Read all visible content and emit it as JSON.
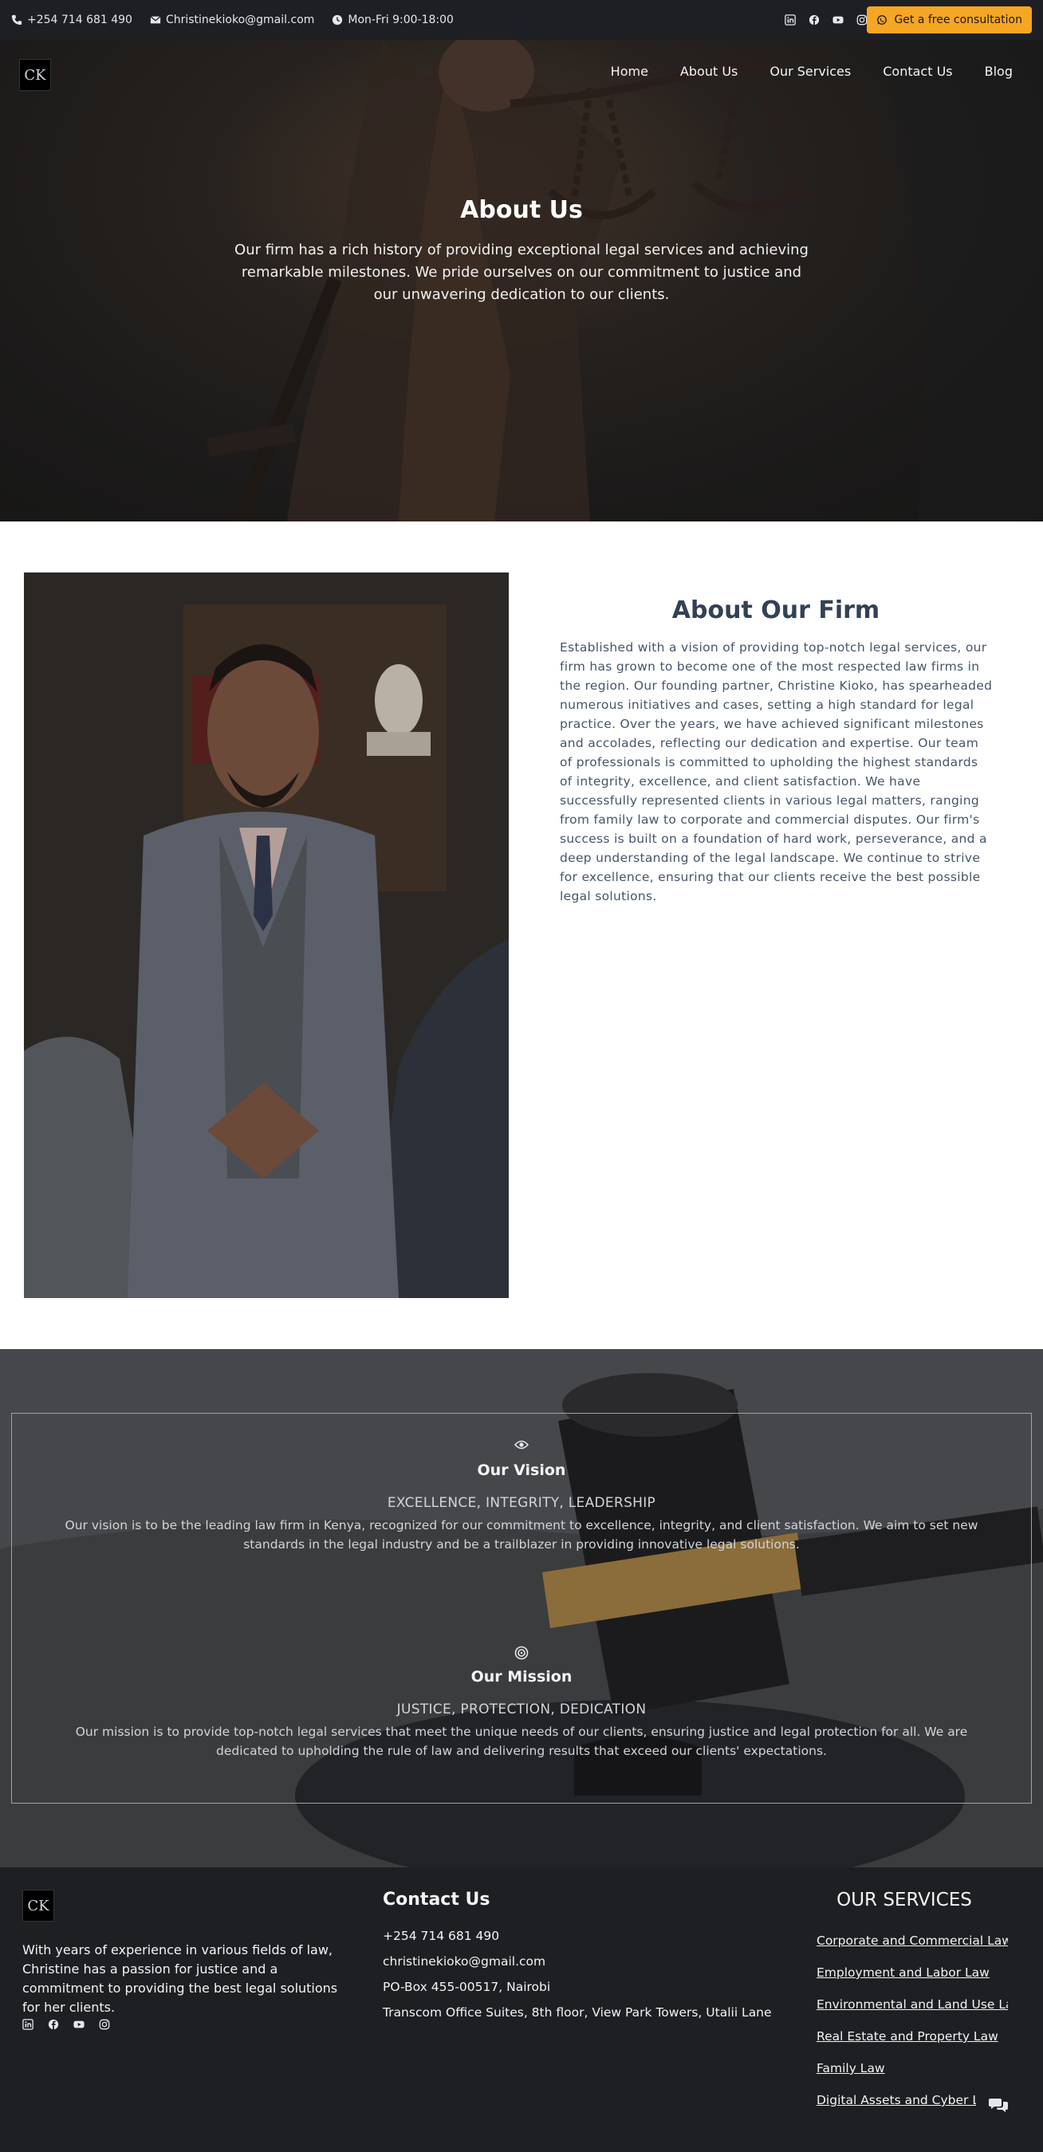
{
  "topbar": {
    "phone": "+254 714 681 490",
    "email": "Christinekioko@gmail.com",
    "hours": "Mon-Fri 9:00-18:00",
    "social_icons": [
      "linkedin-icon",
      "facebook-icon",
      "youtube-icon",
      "instagram-icon"
    ],
    "consult_label": "Get a free consultation",
    "accent": "#f5a623"
  },
  "header": {
    "logo_text": "CK",
    "nav": [
      "Home",
      "About Us",
      "Our Services",
      "Contact Us",
      "Blog"
    ]
  },
  "hero": {
    "title": "About Us",
    "text": "Our firm has a rich history of providing exceptional legal services and achieving remarkable milestones. We pride ourselves on our commitment to justice and our unwavering dedication to our clients."
  },
  "about": {
    "title": "About Our Firm",
    "text": "Established with a vision of providing top-notch legal services, our firm has grown to become one of the most respected law firms in the region. Our founding partner, Christine Kioko, has spearheaded numerous initiatives and cases, setting a high standard for legal practice. Over the years, we have achieved significant milestones and accolades, reflecting our dedication and expertise. Our team of professionals is committed to upholding the highest standards of integrity, excellence, and client satisfaction. We have successfully represented clients in various legal matters, ranging from family law to corporate and commercial disputes. Our firm's success is built on a foundation of hard work, perseverance, and a deep understanding of the legal landscape. We continue to strive for excellence, ensuring that our clients receive the best possible legal solutions."
  },
  "vision": {
    "icon": "eye-icon",
    "title": "Our Vision",
    "tagline": "EXCELLENCE, INTEGRITY, LEADERSHIP",
    "text": "Our vision is to be the leading law firm in Kenya, recognized for our commitment to excellence, integrity, and client satisfaction. We aim to set new standards in the legal industry and be a trailblazer in providing innovative legal solutions."
  },
  "mission": {
    "icon": "target-icon",
    "title": "Our Mission",
    "tagline": "JUSTICE, PROTECTION, DEDICATION",
    "text": "Our mission is to provide top-notch legal services that meet the unique needs of our clients, ensuring justice and legal protection for all. We are dedicated to upholding the rule of law and delivering results that exceed our clients' expectations."
  },
  "footer": {
    "logo_text": "CK",
    "about": "With years of experience in various fields of law, Christine has a passion for justice and a commitment to providing the best legal solutions for her clients.",
    "social_icons": [
      "linkedin-icon",
      "facebook-icon",
      "youtube-icon",
      "instagram-icon"
    ],
    "contact_title": "Contact Us",
    "contact_lines": [
      "+254 714 681 490",
      "christinekioko@gmail.com",
      "PO-Box 455-00517, Nairobi",
      "Transcom Office Suites, 8th floor, View Park Towers, Utalii Lane"
    ],
    "services_title": "OUR SERVICES",
    "services": [
      "Corporate and Commercial Law",
      "Employment and Labor Law",
      "Environmental and Land Use Law",
      "Real Estate and Property Law",
      "Family Law",
      "Digital Assets and Cyber Law"
    ]
  }
}
